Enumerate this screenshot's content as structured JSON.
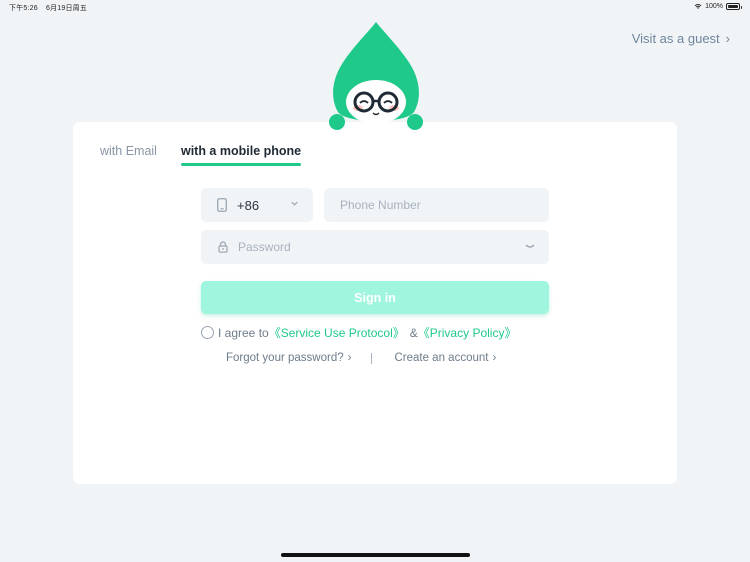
{
  "status_bar": {
    "time": "下午5:26",
    "date": "6月19日周五",
    "battery": "100%"
  },
  "guest_link": {
    "label": "Visit as a guest",
    "chevron": "›"
  },
  "tabs": [
    {
      "label": "with Email",
      "active": false
    },
    {
      "label": "with a mobile phone",
      "active": true
    }
  ],
  "phone": {
    "country_code": "+86",
    "placeholder": "Phone Number",
    "value": ""
  },
  "password": {
    "placeholder": "Password",
    "value": ""
  },
  "signin": {
    "label": "Sign in"
  },
  "agreement": {
    "prefix": "I agree to",
    "service_link": "《Service Use Protocol》",
    "amp": "&",
    "privacy_link": "《Privacy Policy》",
    "checked": false
  },
  "links": {
    "forgot": "Forgot your password?",
    "create": "Create an account",
    "chevron": "›"
  },
  "colors": {
    "accent": "#1ec98a",
    "signin_bg": "#9ff5dd",
    "page_bg": "#f1f4f7"
  },
  "icons": {
    "phone": "phone-icon",
    "lock": "lock-icon",
    "eye": "eye-closed-icon",
    "chevron_down": "chevron-down-icon",
    "wifi": "wifi-icon",
    "battery": "battery-icon"
  }
}
